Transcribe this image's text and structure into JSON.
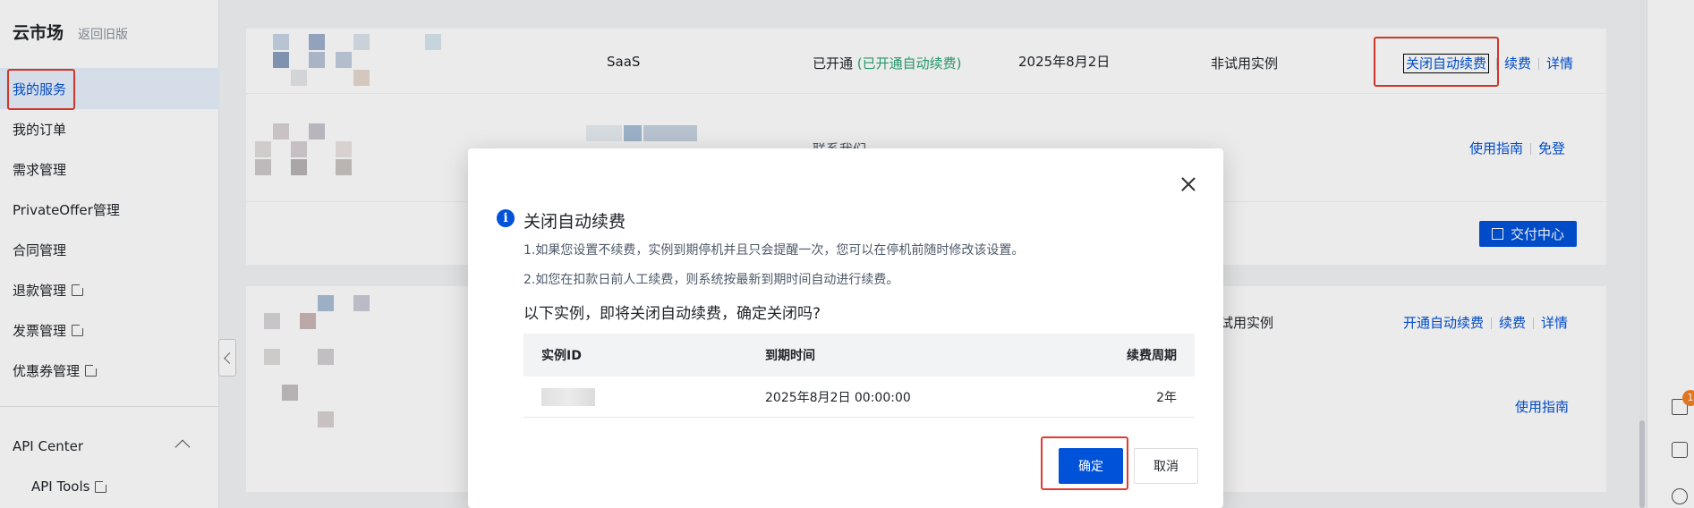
{
  "sidebar": {
    "brand": "云市场",
    "back_link": "返回旧版",
    "items": [
      {
        "label": "我的服务"
      },
      {
        "label": "我的订单"
      },
      {
        "label": "需求管理"
      },
      {
        "label": "PrivateOffer管理"
      },
      {
        "label": "合同管理"
      },
      {
        "label": "退款管理"
      },
      {
        "label": "发票管理"
      },
      {
        "label": "优惠券管理"
      }
    ],
    "api_center": "API Center",
    "api_tools": "API Tools"
  },
  "rows": {
    "row1": {
      "type": "SaaS",
      "status": "已开通",
      "auto_renew": "(已开通自动续费)",
      "date": "2025年8月2日",
      "trial": "非试用实例",
      "action_close": "关闭自动续费",
      "action_renew": "续费",
      "action_detail": "详情"
    },
    "row2": {
      "contact": "联系我们",
      "guide": "使用指南",
      "login": "免登",
      "deliver": "交付中心"
    },
    "row3": {
      "trial": "试用实例",
      "action_open": "开通自动续费",
      "action_renew": "续费",
      "action_detail": "详情"
    },
    "row4": {
      "guide": "使用指南"
    }
  },
  "dialog": {
    "title": "关闭自动续费",
    "line1": "1.如果您设置不续费，实例到期停机并且只会提醒一次，您可以在停机前随时修改该设置。",
    "line2": "2.如您在扣款日前人工续费，则系统按最新到期时间自动进行续费。",
    "question": "以下实例，即将关闭自动续费，确定关闭吗?",
    "table": {
      "headers": [
        "实例ID",
        "到期时间",
        "续费周期"
      ],
      "row": {
        "expire": "2025年8月2日 00:00:00",
        "period": "2年"
      }
    },
    "confirm": "确定",
    "cancel": "取消"
  },
  "rightbar": {
    "cart_badge": "1"
  },
  "colors": {
    "primary": "#0052d9",
    "success": "#2ba471",
    "highlight": "#e23b2e"
  }
}
